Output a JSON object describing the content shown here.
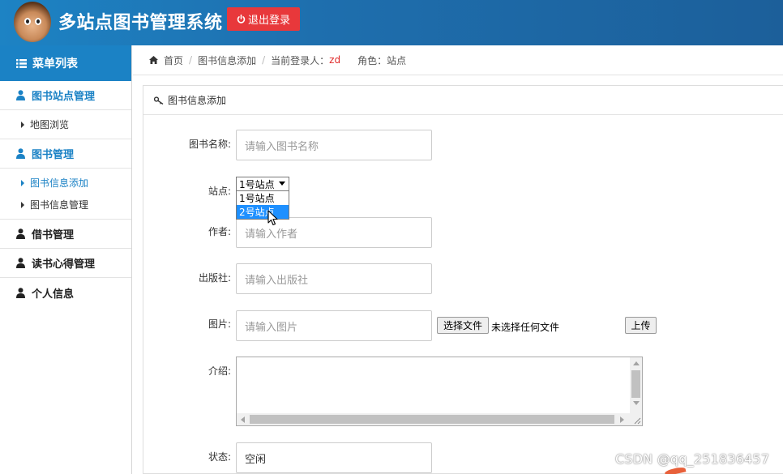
{
  "header": {
    "title": "多站点图书管理系统",
    "logout_label": "退出登录"
  },
  "sidebar": {
    "menu_title": "菜单列表",
    "groups": [
      {
        "label": "图书站点管理",
        "items": [
          "地图浏览"
        ]
      },
      {
        "label": "图书管理",
        "items": [
          "图书信息添加",
          "图书信息管理"
        ]
      },
      {
        "label": "借书管理"
      },
      {
        "label": "读书心得管理"
      },
      {
        "label": "个人信息"
      }
    ]
  },
  "breadcrumb": {
    "home": "首页",
    "page": "图书信息添加",
    "current_user_label": "当前登录人：",
    "current_user": "zd",
    "role_label": "角色：",
    "role": "站点"
  },
  "form": {
    "panel_title": "图书信息添加",
    "name_label": "图书名称:",
    "name_placeholder": "请输入图书名称",
    "site_label": "站点:",
    "site_selected": "1号站点",
    "site_options": [
      "1号站点",
      "2号站点"
    ],
    "site_highlighted": "2号站点",
    "author_label": "作者:",
    "author_placeholder": "请输入作者",
    "publisher_label": "出版社:",
    "publisher_placeholder": "请输入出版社",
    "image_label": "图片:",
    "image_placeholder": "请输入图片",
    "file_button": "选择文件",
    "file_status": "未选择任何文件",
    "upload_button": "上传",
    "intro_label": "介绍:",
    "intro_value": "",
    "status_label": "状态:",
    "status_value": "空闲"
  },
  "watermark": "CSDN @qq_251836457"
}
